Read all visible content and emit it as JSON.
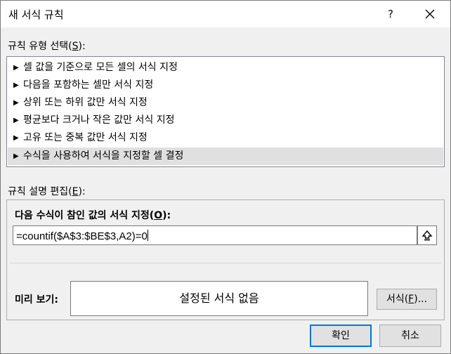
{
  "window": {
    "title": "새 서식 규칙",
    "help_label": "?"
  },
  "rule_type": {
    "label": "규칙 유형 선택(",
    "accel": "S",
    "label_end": "):",
    "items": [
      {
        "label": "셀 값을 기준으로 모든 셀의 서식 지정"
      },
      {
        "label": "다음을 포함하는 셀만 서식 지정"
      },
      {
        "label": "상위 또는 하위 값만 서식 지정"
      },
      {
        "label": "평균보다 크거나 작은 값만 서식 지정"
      },
      {
        "label": "고유 또는 중복 값만 서식 지정"
      },
      {
        "label": "수식을 사용하여 서식을 지정할 셀 결정",
        "selected": true
      }
    ],
    "arrow": "▶"
  },
  "edit": {
    "label": "규칙 설명 편집(",
    "accel": "E",
    "label_end": "):",
    "heading": "다음 수식이 참인 값의 서식 지정(",
    "heading_accel": "O",
    "heading_end": "):",
    "formula_value": "=countif($A$3:$BE$3,A2)=0",
    "preview_label": "미리 보기:",
    "preview_text": "설정된 서식 없음",
    "format_button": "서식(",
    "format_accel": "F",
    "format_end": ")..."
  },
  "footer": {
    "ok_label": "확인",
    "cancel_label": "취소"
  }
}
